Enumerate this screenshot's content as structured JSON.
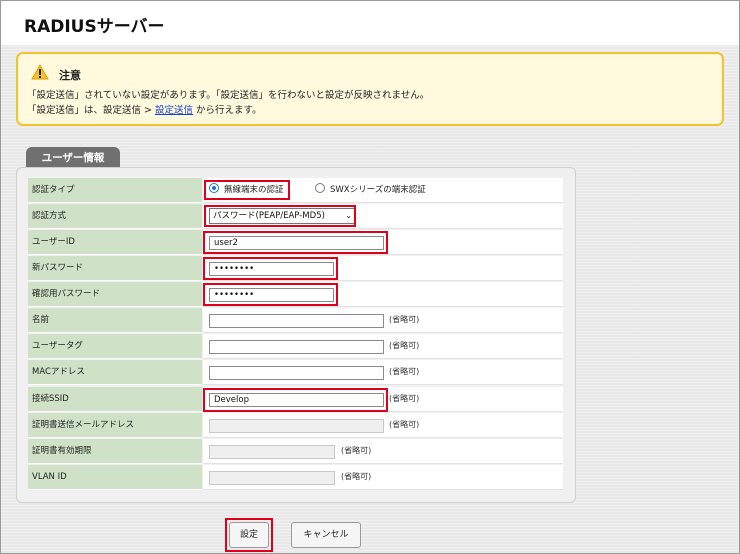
{
  "page": {
    "title": "RADIUSサーバー"
  },
  "notice": {
    "title": "注意",
    "line1": "「設定送信」されていない設定があります。「設定送信」を行わないと設定が反映されません。",
    "line2_prefix": "「設定送信」は、設定送信 > ",
    "line2_link": "設定送信",
    "line2_suffix": " から行えます。",
    "icon": "warning-icon",
    "border_color": "#f1c232",
    "background_color": "#fff9dd"
  },
  "section": {
    "tab_label": "ユーザー情報"
  },
  "form": {
    "auth_type": {
      "label": "認証タイプ",
      "options": [
        "無線端末の認証",
        "SWXシリーズの端末認証"
      ],
      "selected": "無線端末の認証"
    },
    "auth_method": {
      "label": "認証方式",
      "value": "パスワード(PEAP/EAP-MD5)"
    },
    "user_id": {
      "label": "ユーザーID",
      "value": "user2"
    },
    "new_password": {
      "label": "新パスワード",
      "value": "••••••••"
    },
    "confirm_password": {
      "label": "確認用パスワード",
      "value": "••••••••"
    },
    "name": {
      "label": "名前",
      "value": "",
      "note": "(省略可)"
    },
    "user_tag": {
      "label": "ユーザータグ",
      "value": "",
      "note": "(省略可)"
    },
    "mac_address": {
      "label": "MACアドレス",
      "value": "",
      "note": "(省略可)"
    },
    "ssid": {
      "label": "接続SSID",
      "value": "Develop",
      "note": "(省略可)"
    },
    "cert_email": {
      "label": "証明書送信メールアドレス",
      "value": "",
      "note": "(省略可)"
    },
    "cert_expiry": {
      "label": "証明書有効期限",
      "value": "",
      "note": "(省略可)"
    },
    "vlan_id": {
      "label": "VLAN ID",
      "value": "",
      "note": "(省略可)"
    }
  },
  "buttons": {
    "submit": "設定",
    "cancel": "キャンセル"
  },
  "colors": {
    "label_bg": "#cfe2c7",
    "highlight": "#e0001b",
    "link": "#1a3fd0"
  }
}
